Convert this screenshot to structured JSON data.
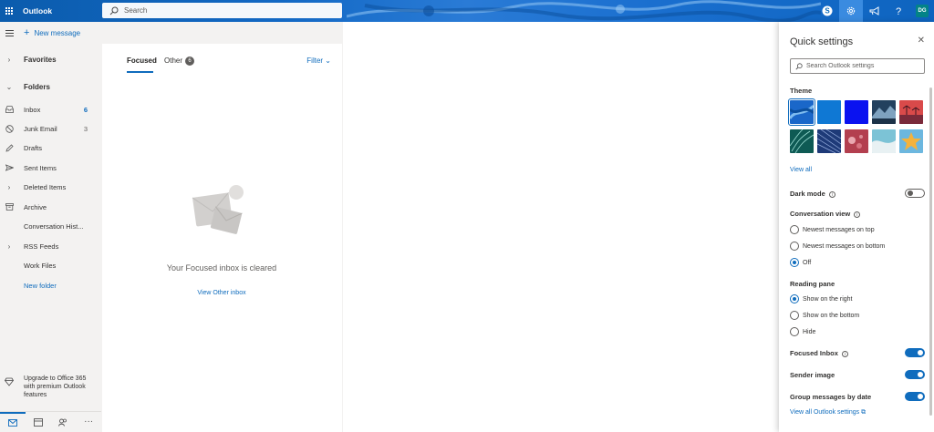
{
  "topbar": {
    "app_title": "Outlook",
    "search_placeholder": "Search",
    "avatar_initials": "DG",
    "icons": [
      "waffle-icon",
      "skype-icon",
      "gear-icon",
      "megaphone-icon",
      "help-icon"
    ]
  },
  "nav": {
    "new_message": "New message",
    "favorites": "Favorites",
    "folders": "Folders",
    "items": [
      {
        "label": "Inbox",
        "count": "6",
        "icon": "inbox-icon"
      },
      {
        "label": "Junk Email",
        "count": "3",
        "icon": "block-icon"
      },
      {
        "label": "Drafts",
        "count": "",
        "icon": "pencil-icon"
      },
      {
        "label": "Sent Items",
        "count": "",
        "icon": "send-icon"
      },
      {
        "label": "Deleted Items",
        "count": "",
        "icon": "chevron-right-icon"
      },
      {
        "label": "Archive",
        "count": "",
        "icon": "archive-icon"
      },
      {
        "label": "Conversation Hist...",
        "count": "",
        "icon": ""
      },
      {
        "label": "RSS Feeds",
        "count": "",
        "icon": "chevron-right-icon"
      },
      {
        "label": "Work Files",
        "count": "",
        "icon": ""
      }
    ],
    "new_folder": "New folder",
    "upgrade_text": "Upgrade to Office 365 with premium Outlook features",
    "bottom_icons": [
      "mail-icon",
      "calendar-icon",
      "people-icon",
      "more-icon"
    ]
  },
  "list": {
    "tab_focused": "Focused",
    "tab_other": "Other",
    "other_count": "6",
    "filter": "Filter",
    "empty_text": "Your Focused inbox is cleared",
    "empty_link": "View Other inbox"
  },
  "quick_settings": {
    "title": "Quick settings",
    "search_placeholder": "Search Outlook settings",
    "theme_label": "Theme",
    "view_all": "View all",
    "dark_mode": "Dark mode",
    "dark_mode_on": false,
    "conversation_view": "Conversation view",
    "conversation_options": [
      "Newest messages on top",
      "Newest messages on bottom",
      "Off"
    ],
    "conversation_selected": 2,
    "reading_pane": "Reading pane",
    "reading_options": [
      "Show on the right",
      "Show on the bottom",
      "Hide"
    ],
    "reading_selected": 0,
    "focused_inbox": "Focused Inbox",
    "focused_inbox_on": true,
    "sender_image": "Sender image",
    "sender_image_on": true,
    "group_by_date": "Group messages by date",
    "group_by_date_on": true,
    "view_all_settings": "View all Outlook settings"
  },
  "colors": {
    "accent": "#0f6cbd",
    "avatar": "#038387"
  }
}
